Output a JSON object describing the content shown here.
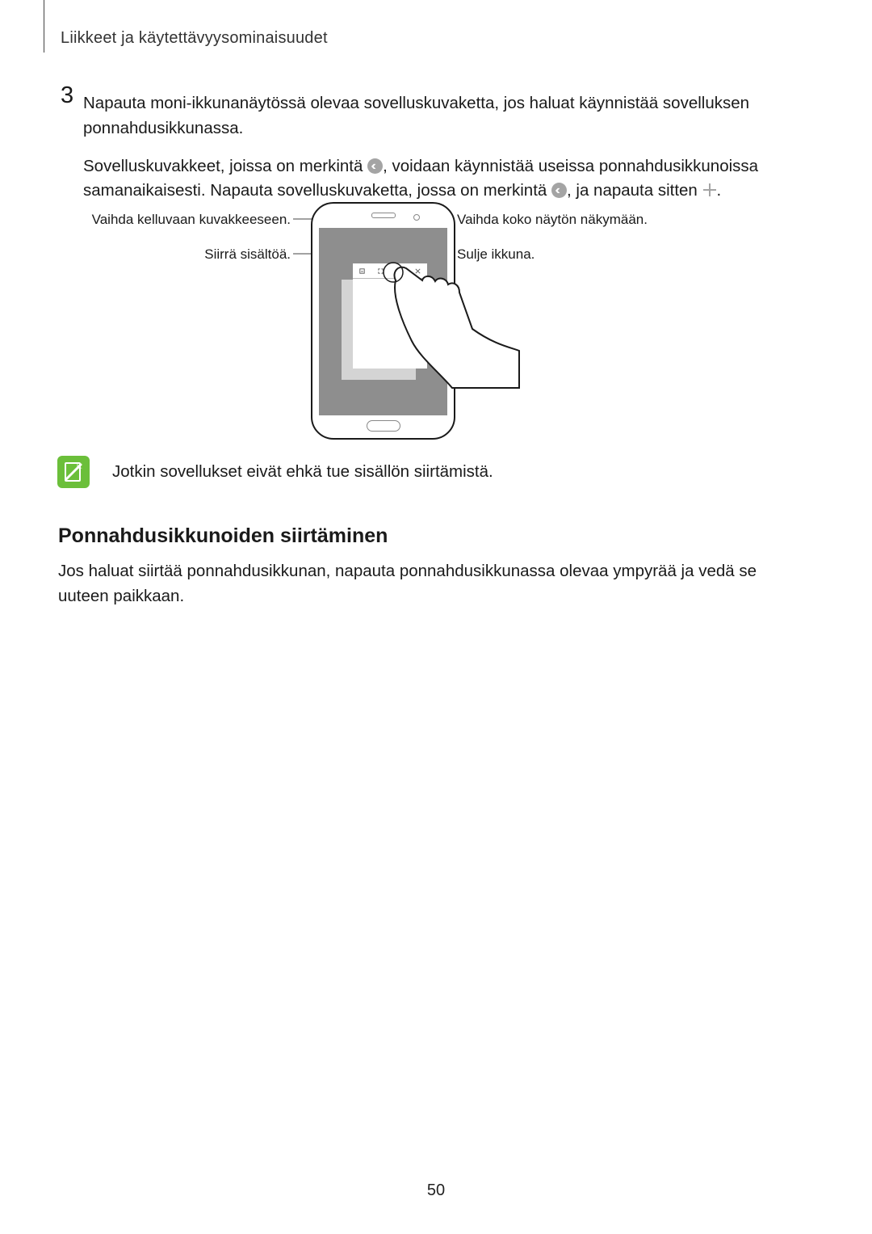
{
  "header": "Liikkeet ja käytettävyysominaisuudet",
  "step_number": "3",
  "para1": "Napauta moni-ikkunanäytössä olevaa sovelluskuvaketta, jos haluat käynnistää sovelluksen ponnahdusikkunassa.",
  "para2a": "Sovelluskuvakkeet, joissa on merkintä ",
  "para2b": ", voidaan käynnistää useissa ponnahdusikkunoissa samanaikaisesti. Napauta sovelluskuvaketta, jossa on merkintä ",
  "para2c": ", ja napauta sitten ",
  "para2d": ".",
  "callouts": {
    "top_left": "Vaihda kelluvaan kuvakkeeseen.",
    "bottom_left": "Siirrä sisältöä.",
    "top_right": "Vaihda koko näytön näkymään.",
    "bottom_right": "Sulje ikkuna."
  },
  "note": "Jotkin sovellukset eivät ehkä tue sisällön siirtämistä.",
  "section_heading": "Ponnahdusikkunoiden siirtäminen",
  "section_para": "Jos haluat siirtää ponnahdusikkunan, napauta ponnahdusikkunassa olevaa ympyrää ja vedä se uuteen paikkaan.",
  "page_number": "50"
}
